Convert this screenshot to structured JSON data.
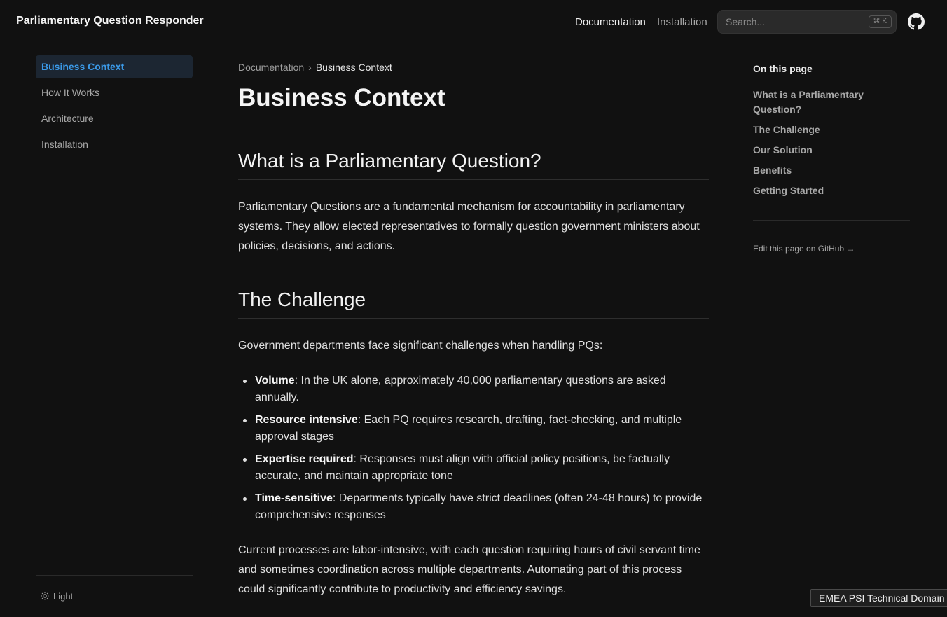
{
  "header": {
    "brand": "Parliamentary Question Responder",
    "nav": [
      {
        "label": "Documentation"
      },
      {
        "label": "Installation"
      }
    ],
    "search": {
      "placeholder": "Search...",
      "shortcut": "⌘ K"
    },
    "github_icon": "github-icon"
  },
  "sidebar": {
    "items": [
      {
        "label": "Business Context"
      },
      {
        "label": "How It Works"
      },
      {
        "label": "Architecture"
      },
      {
        "label": "Installation"
      }
    ],
    "theme_toggle": {
      "label": "Light",
      "icon": "sun-icon"
    }
  },
  "main": {
    "breadcrumb": {
      "parent": "Documentation",
      "current": "Business Context"
    },
    "title": "Business Context",
    "sections": [
      {
        "heading": "What is a Parliamentary Question?",
        "paragraph": "Parliamentary Questions are a fundamental mechanism for accountability in parliamentary systems. They allow elected representatives to formally question government ministers about policies, decisions, and actions."
      },
      {
        "heading": "The Challenge",
        "intro": "Government departments face significant challenges when handling PQs:",
        "bullets": [
          {
            "term": "Volume",
            "text": ": In the UK alone, approximately 40,000 parliamentary questions are asked annually."
          },
          {
            "term": "Resource intensive",
            "text": ": Each PQ requires research, drafting, fact-checking, and multiple approval stages"
          },
          {
            "term": "Expertise required",
            "text": ": Responses must align with official policy positions, be factually accurate, and maintain appropriate tone"
          },
          {
            "term": "Time-sensitive",
            "text": ": Departments typically have strict deadlines (often 24-48 hours) to provide comprehensive responses"
          }
        ],
        "closing": "Current processes are labor-intensive, with each question requiring hours of civil servant time and sometimes coordination across multiple departments. Automating part of this process could significantly contribute to productivity and efficiency savings."
      }
    ]
  },
  "toc": {
    "title": "On this page",
    "links": [
      {
        "label": "What is a Parliamentary Question?"
      },
      {
        "label": "The Challenge"
      },
      {
        "label": "Our Solution"
      },
      {
        "label": "Benefits"
      },
      {
        "label": "Getting Started"
      }
    ],
    "edit_link": "Edit this page on GitHub →"
  },
  "footer_badge": "EMEA PSI Technical Domain",
  "colors": {
    "background": "#111111",
    "accent": "#3b9ae8",
    "active_bg": "#1c2632"
  }
}
